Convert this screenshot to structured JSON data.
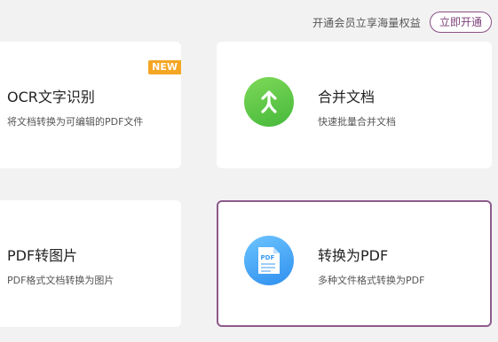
{
  "header": {
    "promo_text": "开通会员立享海量权益",
    "open_button_label": "立即开通"
  },
  "cards": [
    {
      "title": "OCR文字识别",
      "description": "将文档转换为可编辑的PDF文件",
      "badge": "NEW"
    },
    {
      "title": "合并文档",
      "description": "快速批量合并文档",
      "icon": "merge-arrow-icon"
    },
    {
      "title": "PDF转图片",
      "description": "PDF格式文档转换为图片"
    },
    {
      "title": "转换为PDF",
      "description": "多种文件格式转换为PDF",
      "icon": "pdf-document-icon",
      "icon_text": "PDF",
      "selected": true
    }
  ],
  "colors": {
    "accent": "#7b3f78",
    "badge": "#f5a623",
    "merge_icon": "#4cbb3f",
    "pdf_icon": "#3a9af0"
  }
}
